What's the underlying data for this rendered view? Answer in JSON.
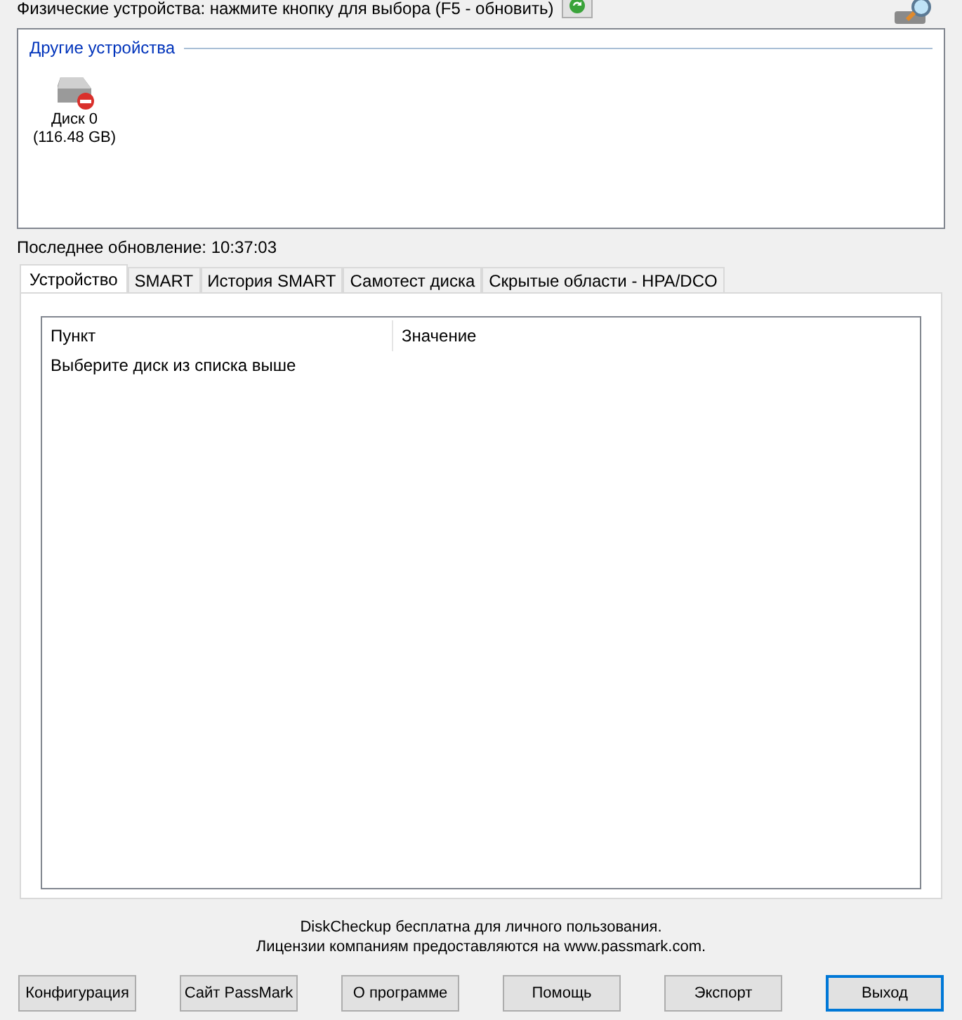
{
  "header": {
    "label": "Физические устройства: нажмите кнопку для выбора (F5 - обновить)"
  },
  "devices": {
    "group_title": "Другие устройства",
    "items": [
      {
        "name": "Диск 0",
        "size": "(116.48 GB)"
      }
    ]
  },
  "last_update": "Последнее обновление: 10:37:03",
  "tabs": [
    {
      "label": "Устройство",
      "selected": true
    },
    {
      "label": "SMART",
      "selected": false
    },
    {
      "label": "История SMART",
      "selected": false
    },
    {
      "label": "Самотест диска",
      "selected": false
    },
    {
      "label": "Скрытые области - HPA/DCO",
      "selected": false
    }
  ],
  "table": {
    "columns": [
      "Пункт",
      "Значение"
    ],
    "message": "Выберите диск из списка выше"
  },
  "footer": [
    "DiskCheckup бесплатна для личного пользования.",
    "Лицензии компаниям предоставляются на www.passmark.com."
  ],
  "buttons": [
    {
      "label": "Конфигурация",
      "default": false
    },
    {
      "label": "Сайт PassMark",
      "default": false
    },
    {
      "label": "О программе",
      "default": false
    },
    {
      "label": "Помощь",
      "default": false
    },
    {
      "label": "Экспорт",
      "default": false
    },
    {
      "label": "Выход",
      "default": true
    }
  ]
}
